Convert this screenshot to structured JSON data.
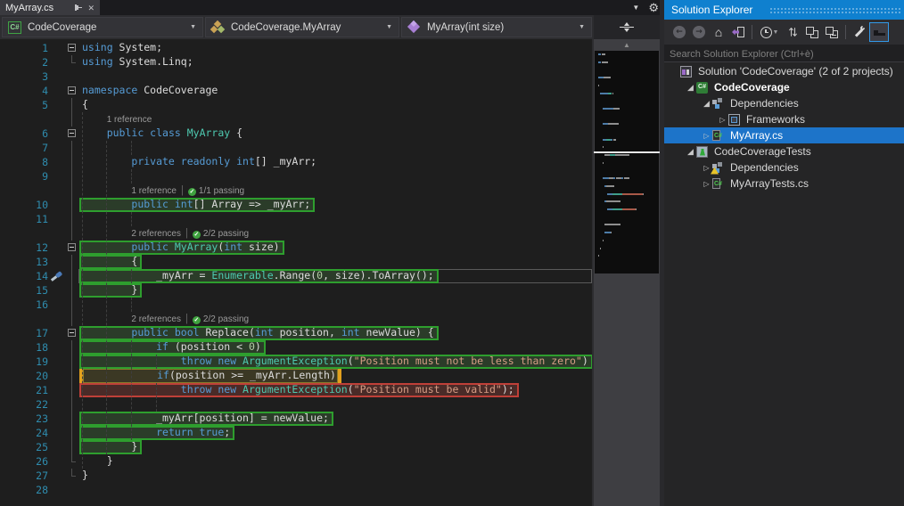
{
  "editor_tab": {
    "title": "MyArray.cs"
  },
  "tab_strip": {
    "icons": [
      "tab-list-dropdown-icon",
      "gear-icon"
    ]
  },
  "navbar": {
    "project": {
      "label": "CodeCoverage",
      "icon": "csharp-project-icon"
    },
    "type": {
      "label": "CodeCoverage.MyArray",
      "icon": "class-icon"
    },
    "member": {
      "label": "MyArray(int size)",
      "icon": "method-icon"
    }
  },
  "editor": {
    "rows": [
      {
        "t": "code",
        "n": "1",
        "out": "box",
        "segs": [
          [
            "k",
            "using"
          ],
          [
            "p",
            " System;"
          ]
        ]
      },
      {
        "t": "code",
        "n": "2",
        "out": "end",
        "segs": [
          [
            "k",
            "using"
          ],
          [
            "p",
            " System.Linq;"
          ]
        ]
      },
      {
        "t": "code",
        "n": "3"
      },
      {
        "t": "code",
        "n": "4",
        "out": "box",
        "segs": [
          [
            "k",
            "namespace"
          ],
          [
            "p",
            " CodeCoverage"
          ]
        ]
      },
      {
        "t": "code",
        "n": "5",
        "out": "line",
        "segs": [
          [
            "p",
            "{"
          ]
        ]
      },
      {
        "t": "lens",
        "out": "line",
        "pad": "    ",
        "refs": "1 reference"
      },
      {
        "t": "code",
        "n": "6",
        "out": "box",
        "segs": [
          [
            "p",
            "    "
          ],
          [
            "k",
            "public class "
          ],
          [
            "t",
            "MyArray"
          ],
          [
            "p",
            " {"
          ]
        ]
      },
      {
        "t": "code",
        "n": "7",
        "out": "line"
      },
      {
        "t": "code",
        "n": "8",
        "out": "line",
        "segs": [
          [
            "p",
            "        "
          ],
          [
            "k",
            "private readonly int"
          ],
          [
            "p",
            "[] _myArr;"
          ]
        ]
      },
      {
        "t": "code",
        "n": "9",
        "out": "line"
      },
      {
        "t": "lens",
        "out": "line",
        "pad": "        ",
        "refs": "1 reference",
        "pass": "1/1 passing"
      },
      {
        "t": "code",
        "n": "10",
        "out": "line",
        "cov": "g",
        "segs": [
          [
            "p",
            "        "
          ],
          [
            "k",
            "public int"
          ],
          [
            "p",
            "[] Array => _myArr;"
          ]
        ]
      },
      {
        "t": "code",
        "n": "11",
        "out": "line"
      },
      {
        "t": "lens",
        "out": "line",
        "pad": "        ",
        "refs": "2 references",
        "pass": "2/2 passing"
      },
      {
        "t": "code",
        "n": "12",
        "out": "box",
        "cov": "g",
        "segs": [
          [
            "p",
            "        "
          ],
          [
            "k",
            "public "
          ],
          [
            "t",
            "MyArray"
          ],
          [
            "p",
            "("
          ],
          [
            "k",
            "int"
          ],
          [
            "p",
            " size)"
          ]
        ]
      },
      {
        "t": "code",
        "n": "13",
        "out": "line",
        "cov": "g",
        "segs": [
          [
            "p",
            "        {"
          ]
        ]
      },
      {
        "t": "code",
        "n": "14",
        "out": "line",
        "cov": "g",
        "cur": true,
        "tool": true,
        "segs": [
          [
            "p",
            "            _myArr = "
          ],
          [
            "t",
            "Enumerable"
          ],
          [
            "p",
            ".Range("
          ],
          [
            "n",
            "0"
          ],
          [
            "p",
            ", size).ToArray();"
          ]
        ]
      },
      {
        "t": "code",
        "n": "15",
        "out": "line",
        "cov": "g",
        "segs": [
          [
            "p",
            "        }"
          ]
        ]
      },
      {
        "t": "code",
        "n": "16",
        "out": "line"
      },
      {
        "t": "lens",
        "out": "line",
        "pad": "        ",
        "refs": "2 references",
        "pass": "2/2 passing"
      },
      {
        "t": "code",
        "n": "17",
        "out": "box",
        "cov": "g",
        "segs": [
          [
            "p",
            "        "
          ],
          [
            "k",
            "public bool "
          ],
          [
            "p",
            "Replace("
          ],
          [
            "k",
            "int"
          ],
          [
            "p",
            " position, "
          ],
          [
            "k",
            "int"
          ],
          [
            "p",
            " newValue) {"
          ]
        ]
      },
      {
        "t": "code",
        "n": "18",
        "out": "line",
        "cov": "g",
        "segs": [
          [
            "p",
            "            "
          ],
          [
            "k",
            "if"
          ],
          [
            "p",
            " (position < "
          ],
          [
            "n",
            "0"
          ],
          [
            "p",
            ")"
          ]
        ]
      },
      {
        "t": "code",
        "n": "19",
        "out": "line",
        "cov": "g",
        "segs": [
          [
            "p",
            "                "
          ],
          [
            "k",
            "throw new "
          ],
          [
            "t",
            "ArgumentException"
          ],
          [
            "p",
            "("
          ],
          [
            "s",
            "\"Position must not be less than zero\""
          ],
          [
            "p",
            ")"
          ]
        ]
      },
      {
        "t": "code",
        "n": "20",
        "out": "line",
        "cov": "p",
        "segs": [
          [
            "p",
            "            "
          ],
          [
            "k",
            "if"
          ],
          [
            "p",
            "(position >= _myArr.Length)"
          ]
        ]
      },
      {
        "t": "code",
        "n": "21",
        "out": "line",
        "cov": "r",
        "segs": [
          [
            "p",
            "                "
          ],
          [
            "k",
            "throw new "
          ],
          [
            "t",
            "ArgumentException"
          ],
          [
            "p",
            "("
          ],
          [
            "s",
            "\"Position must be valid\""
          ],
          [
            "p",
            ");"
          ]
        ]
      },
      {
        "t": "code",
        "n": "22",
        "out": "line"
      },
      {
        "t": "code",
        "n": "23",
        "out": "line",
        "cov": "g",
        "segs": [
          [
            "p",
            "            _myArr[position] = newValue;"
          ]
        ]
      },
      {
        "t": "code",
        "n": "24",
        "out": "line",
        "cov": "g",
        "segs": [
          [
            "p",
            "            "
          ],
          [
            "k",
            "return true"
          ],
          [
            "p",
            ";"
          ]
        ]
      },
      {
        "t": "code",
        "n": "25",
        "out": "line",
        "cov": "g",
        "segs": [
          [
            "p",
            "        }"
          ]
        ]
      },
      {
        "t": "code",
        "n": "26",
        "out": "end",
        "segs": [
          [
            "p",
            "    }"
          ]
        ]
      },
      {
        "t": "code",
        "n": "27",
        "out": "end",
        "segs": [
          [
            "p",
            "}"
          ]
        ]
      },
      {
        "t": "code",
        "n": "28"
      }
    ]
  },
  "solution_explorer": {
    "title": "Solution Explorer",
    "search_placeholder": "Search Solution Explorer (Ctrl+è)",
    "toolbar": [
      {
        "icon": "back-icon"
      },
      {
        "icon": "forward-icon"
      },
      {
        "icon": "home-icon"
      },
      {
        "icon": "sync-with-active-document-icon"
      },
      {
        "icon": "separator"
      },
      {
        "icon": "pending-changes-filter-icon",
        "dropdown": true
      },
      {
        "icon": "refresh-icon"
      },
      {
        "icon": "collapse-all-icon"
      },
      {
        "icon": "show-all-files-icon"
      },
      {
        "icon": "separator"
      },
      {
        "icon": "properties-wrench-icon"
      },
      {
        "icon": "preview-selected-items-icon",
        "active": true
      }
    ],
    "tree": [
      {
        "level": 0,
        "expander": "none",
        "icon": "solution",
        "label": "Solution 'CodeCoverage' (2 of 2 projects)"
      },
      {
        "level": 1,
        "expander": "expanded",
        "icon": "csproj",
        "label": "CodeCoverage",
        "bold": true
      },
      {
        "level": 2,
        "expander": "expanded",
        "icon": "deps",
        "label": "Dependencies"
      },
      {
        "level": 3,
        "expander": "collapsed",
        "icon": "frameworks",
        "label": "Frameworks"
      },
      {
        "level": 2,
        "expander": "collapsed",
        "icon": "csfile",
        "label": "MyArray.cs",
        "selected": true
      },
      {
        "level": 1,
        "expander": "expanded",
        "icon": "testproj",
        "label": "CodeCoverageTests"
      },
      {
        "level": 2,
        "expander": "collapsed",
        "icon": "deps",
        "warn": true,
        "label": "Dependencies"
      },
      {
        "level": 2,
        "expander": "collapsed",
        "icon": "csfile",
        "label": "MyArrayTests.cs"
      }
    ]
  },
  "colors": {
    "editor_background": "#1e1e1e",
    "keyword": "#569cd6",
    "type": "#4ec9b0",
    "string": "#d69d85",
    "number": "#b5cea8",
    "line_number": "#2f8cae",
    "coverage_covered_border": "#2e9e2e",
    "coverage_uncovered_border": "#bf4038",
    "coverage_partial_cap": "#e2a01d",
    "tool_window_title": "#0f80cf",
    "tree_selection": "#1d74c9"
  }
}
